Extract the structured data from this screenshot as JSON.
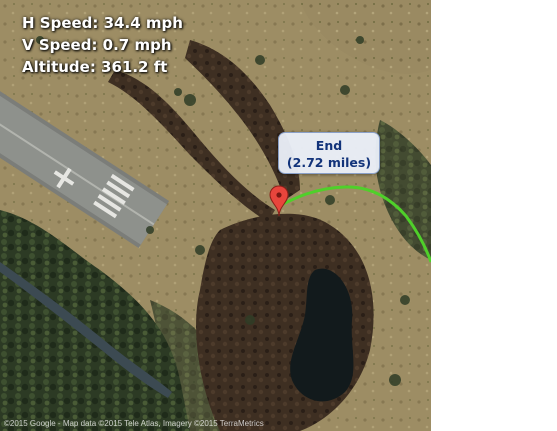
{
  "telemetry": {
    "h_speed": "H Speed: 34.4 mph",
    "v_speed": "V Speed: 0.7 mph",
    "altitude": "Altitude: 361.2 ft"
  },
  "end_marker": {
    "title": "End",
    "distance": "(2.72 miles)"
  },
  "map": {
    "attribution": "©2015 Google - Map data ©2015 Tele Atlas, Imagery ©2015 TerraMetrics",
    "track_color": "#4fd02a",
    "marker_color": "#e8453c",
    "marker_icon": "map-pin-icon"
  }
}
